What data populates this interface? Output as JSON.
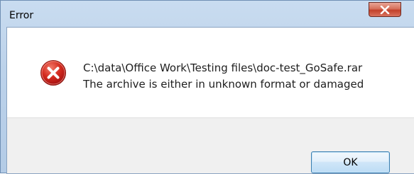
{
  "window": {
    "title": "Error"
  },
  "title_bar": {
    "close_icon": "close-icon"
  },
  "message": {
    "icon": "error-icon",
    "path": "C:\\data\\Office Work\\Testing files\\doc-test_GoSafe.rar",
    "text": "The archive is either in unknown format or damaged"
  },
  "buttons": {
    "ok_label": "OK"
  },
  "colors": {
    "close_button": "#c9482f",
    "error_icon": "#c21a1a",
    "ok_border": "#3c7fb1",
    "title_bar": "#bcd2ea"
  }
}
